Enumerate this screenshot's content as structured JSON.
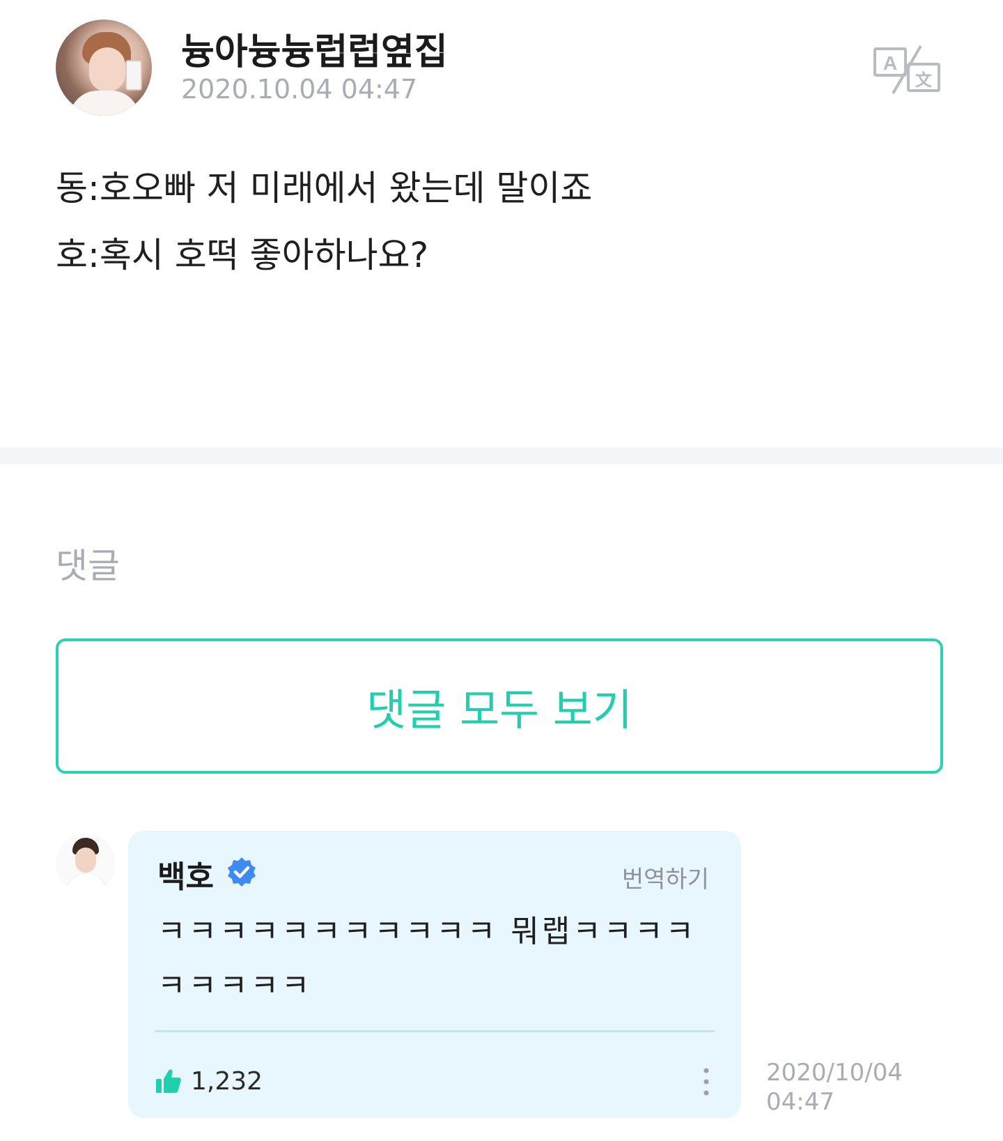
{
  "post": {
    "author": "늉아늉늉럽럽옆집",
    "timestamp": "2020.10.04 04:47",
    "translate_icon": "translate-icon",
    "lines": [
      "동:호오빠 저 미래에서 왔는데 말이죠",
      "호:혹시 호떡 좋아하나요?"
    ]
  },
  "comments_section": {
    "heading": "댓글",
    "view_all_label": "댓글 모두 보기",
    "accent_color": "#27d3b4",
    "bubble_color": "#e8f6fd"
  },
  "comment": {
    "author": "백호",
    "verified_icon": "verified-badge-icon",
    "translate_label": "번역하기",
    "text": "ㅋㅋㅋㅋㅋㅋㅋㅋㅋㅋㅋ 뭐랩ㅋㅋㅋㅋㅋㅋㅋㅋㅋ",
    "like_icon": "thumbs-up-icon",
    "like_count": "1,232",
    "more_icon": "more-vertical-icon",
    "date_line1": "2020/10/04",
    "date_line2": "04:47"
  }
}
